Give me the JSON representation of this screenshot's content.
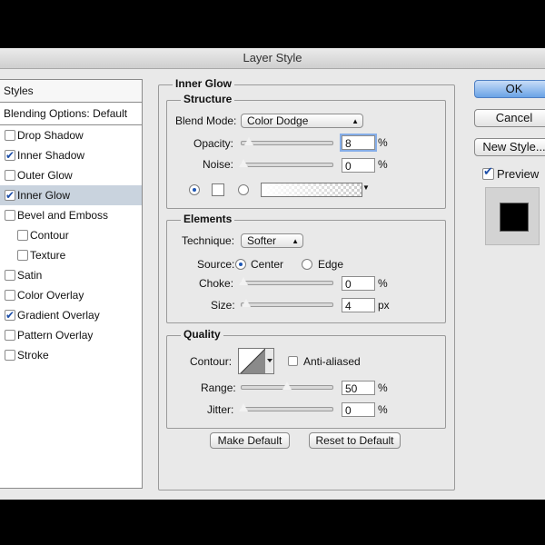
{
  "window": {
    "title": "Layer Style"
  },
  "styles_panel": {
    "header": "Styles",
    "blending_options": "Blending Options: Default",
    "items": [
      {
        "label": "Drop Shadow",
        "checked": false,
        "sub": false,
        "selected": false
      },
      {
        "label": "Inner Shadow",
        "checked": true,
        "sub": false,
        "selected": false
      },
      {
        "label": "Outer Glow",
        "checked": false,
        "sub": false,
        "selected": false
      },
      {
        "label": "Inner Glow",
        "checked": true,
        "sub": false,
        "selected": true
      },
      {
        "label": "Bevel and Emboss",
        "checked": false,
        "sub": false,
        "selected": false
      },
      {
        "label": "Contour",
        "checked": false,
        "sub": true,
        "selected": false
      },
      {
        "label": "Texture",
        "checked": false,
        "sub": true,
        "selected": false
      },
      {
        "label": "Satin",
        "checked": false,
        "sub": false,
        "selected": false
      },
      {
        "label": "Color Overlay",
        "checked": false,
        "sub": false,
        "selected": false
      },
      {
        "label": "Gradient Overlay",
        "checked": true,
        "sub": false,
        "selected": false
      },
      {
        "label": "Pattern Overlay",
        "checked": false,
        "sub": false,
        "selected": false
      },
      {
        "label": "Stroke",
        "checked": false,
        "sub": false,
        "selected": false
      }
    ]
  },
  "inner_glow": {
    "title": "Inner Glow",
    "structure": {
      "title": "Structure",
      "blend_mode_label": "Blend Mode:",
      "blend_mode_value": "Color Dodge",
      "opacity_label": "Opacity:",
      "opacity_value": "8",
      "opacity_unit": "%",
      "noise_label": "Noise:",
      "noise_value": "0",
      "noise_unit": "%",
      "color_mode": "solid"
    },
    "elements": {
      "title": "Elements",
      "technique_label": "Technique:",
      "technique_value": "Softer",
      "source_label": "Source:",
      "source_center": "Center",
      "source_edge": "Edge",
      "source_selected": "Center",
      "choke_label": "Choke:",
      "choke_value": "0",
      "choke_unit": "%",
      "size_label": "Size:",
      "size_value": "4",
      "size_unit": "px"
    },
    "quality": {
      "title": "Quality",
      "contour_label": "Contour:",
      "anti_aliased_label": "Anti-aliased",
      "anti_aliased": false,
      "range_label": "Range:",
      "range_value": "50",
      "range_unit": "%",
      "jitter_label": "Jitter:",
      "jitter_value": "0",
      "jitter_unit": "%"
    },
    "make_default": "Make Default",
    "reset_to_default": "Reset to Default"
  },
  "actions": {
    "ok": "OK",
    "cancel": "Cancel",
    "new_style": "New Style...",
    "preview_label": "Preview",
    "preview_checked": true
  }
}
